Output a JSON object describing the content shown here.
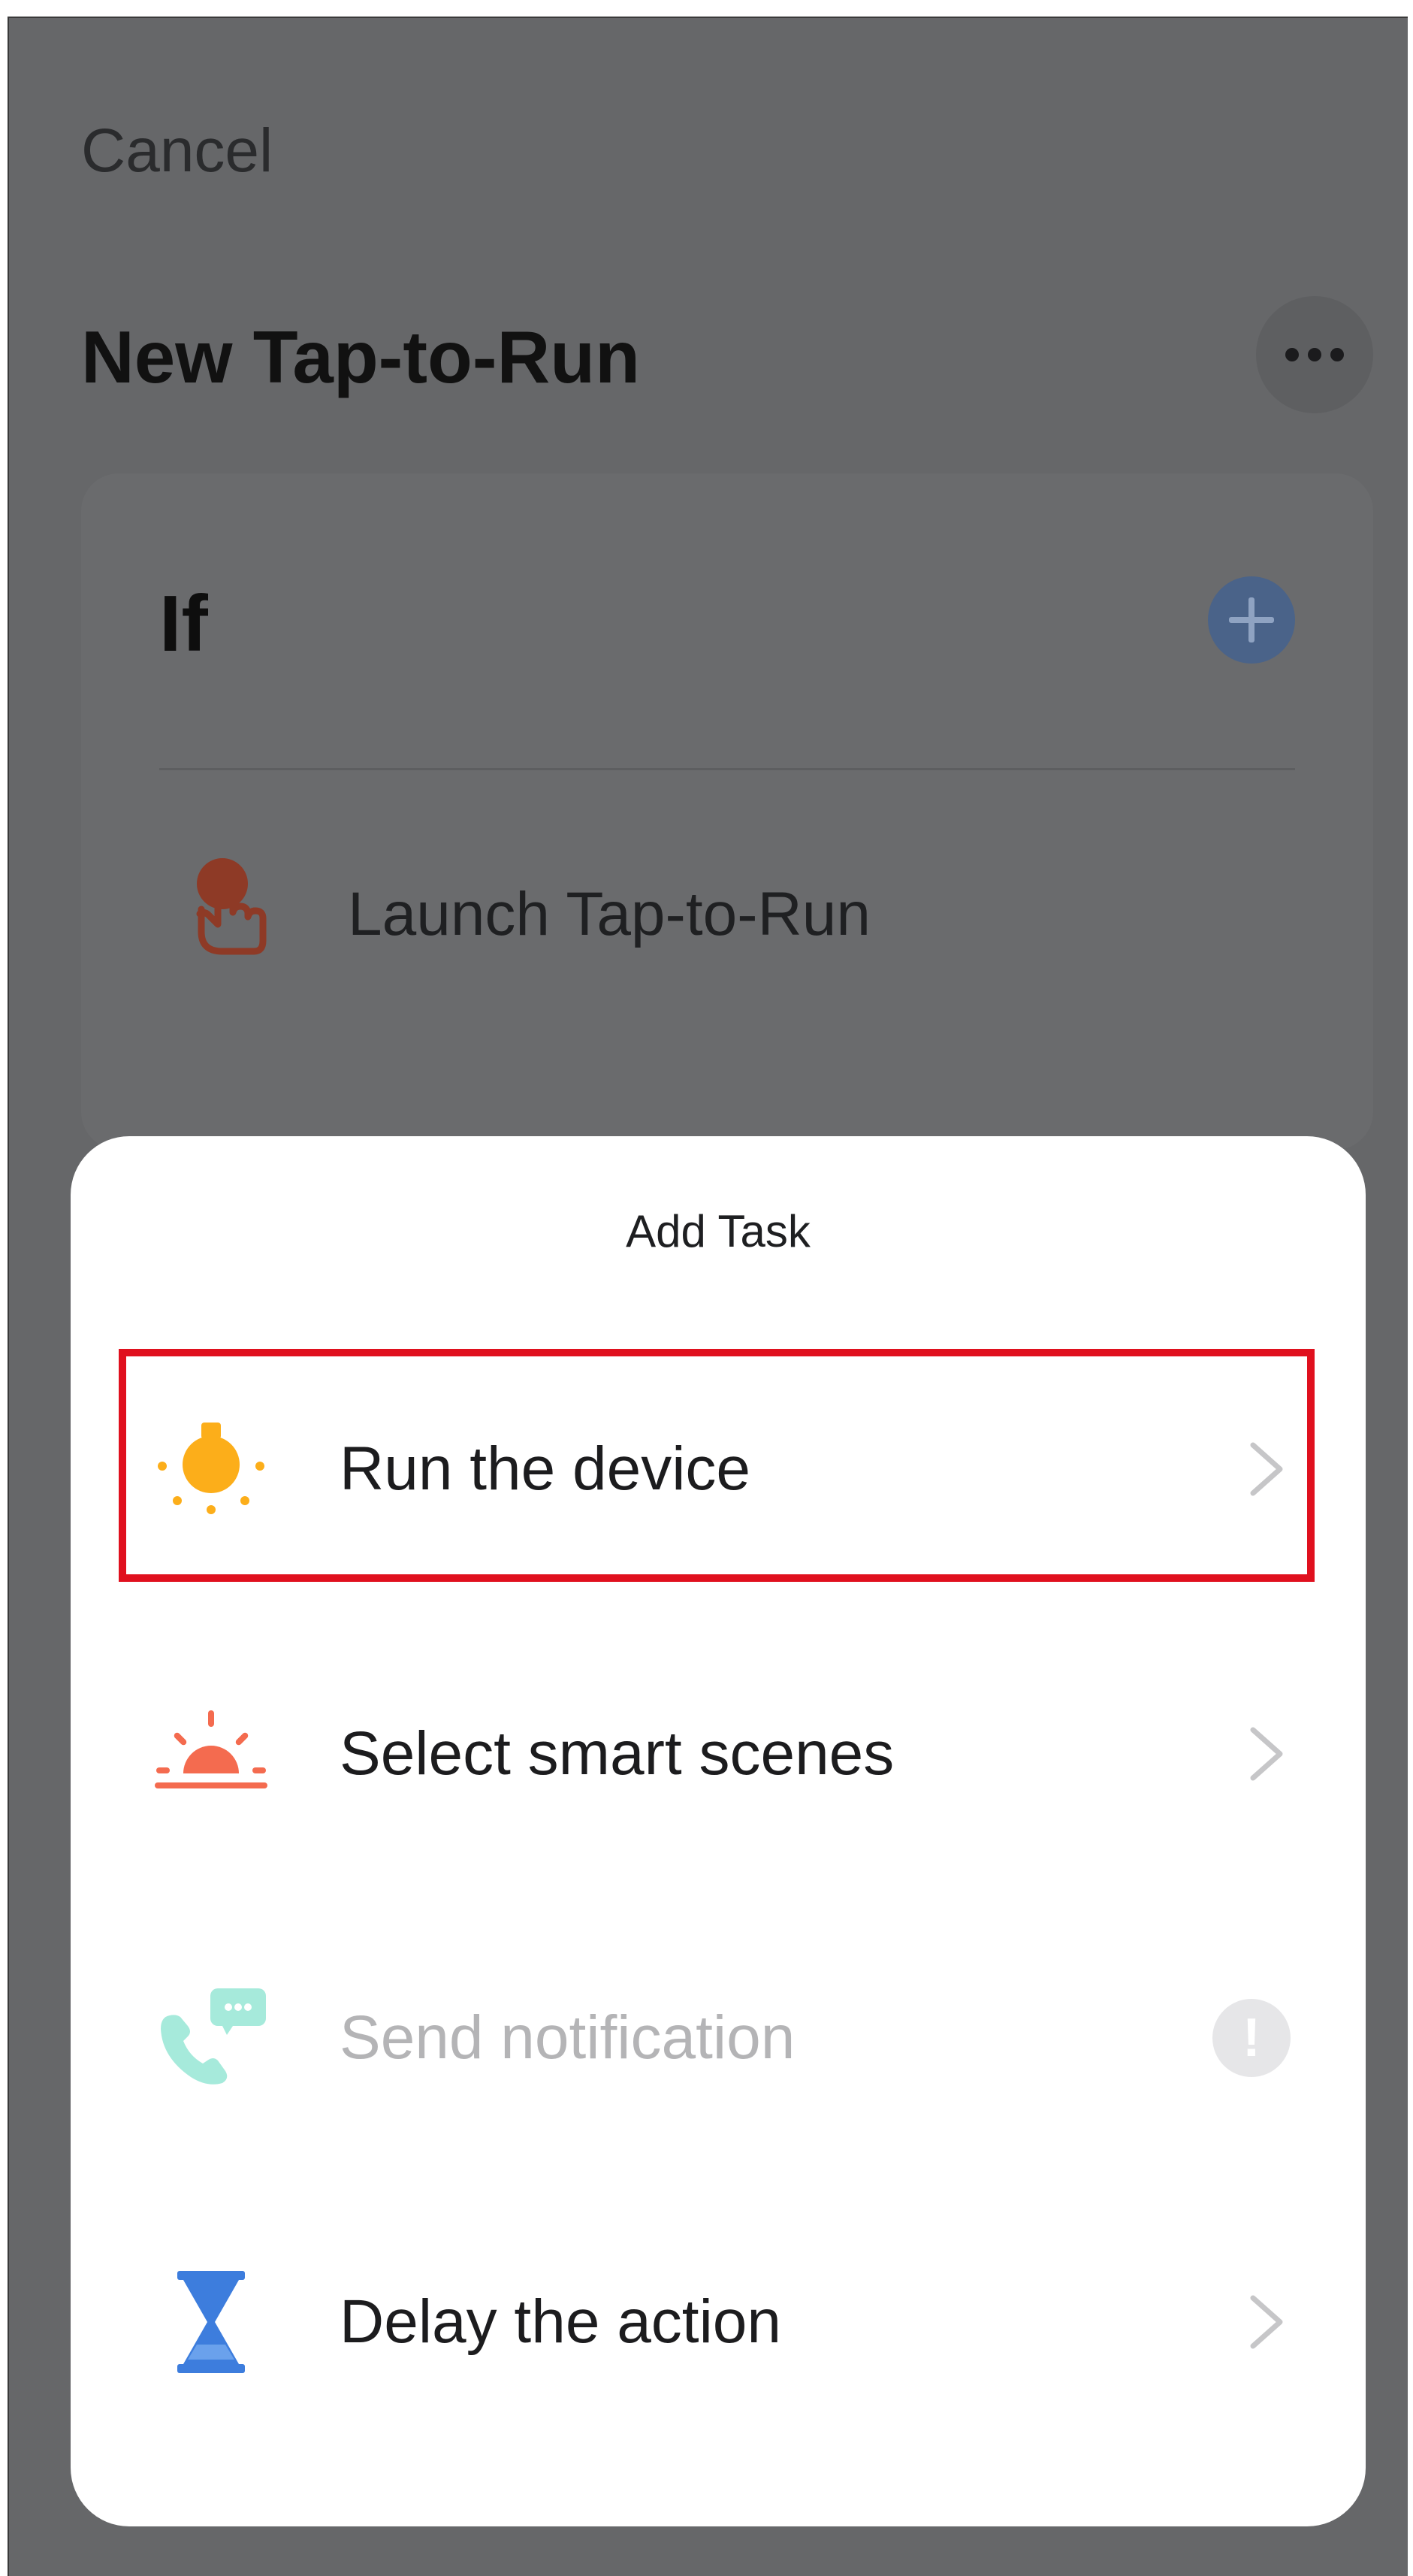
{
  "header": {
    "cancel_label": "Cancel",
    "title": "New Tap-to-Run",
    "more_icon": "more-horizontal-icon"
  },
  "if_section": {
    "label": "If",
    "add_icon": "plus-circle-icon",
    "condition": {
      "icon": "tap-hand-icon",
      "label": "Launch Tap-to-Run"
    }
  },
  "add_task_sheet": {
    "title": "Add Task",
    "items": [
      {
        "icon": "bulb-icon",
        "label": "Run the device",
        "enabled": true,
        "trailing": "chevron-right-icon",
        "highlighted": true
      },
      {
        "icon": "sunrise-icon",
        "label": "Select smart scenes",
        "enabled": true,
        "trailing": "chevron-right-icon"
      },
      {
        "icon": "phone-message-icon",
        "label": "Send notification",
        "enabled": false,
        "trailing": "exclamation-badge-icon",
        "trailing_text": "!"
      },
      {
        "icon": "hourglass-icon",
        "label": "Delay the action",
        "enabled": true,
        "trailing": "chevron-right-icon"
      }
    ]
  },
  "colors": {
    "overlay": "#666769",
    "sheet_bg": "#ffffff",
    "highlight_border": "#e0101e",
    "bulb": "#fcae1a",
    "sunrise": "#f46b4f",
    "notification": "#a6eadb",
    "hourglass": "#3d7ddd"
  }
}
